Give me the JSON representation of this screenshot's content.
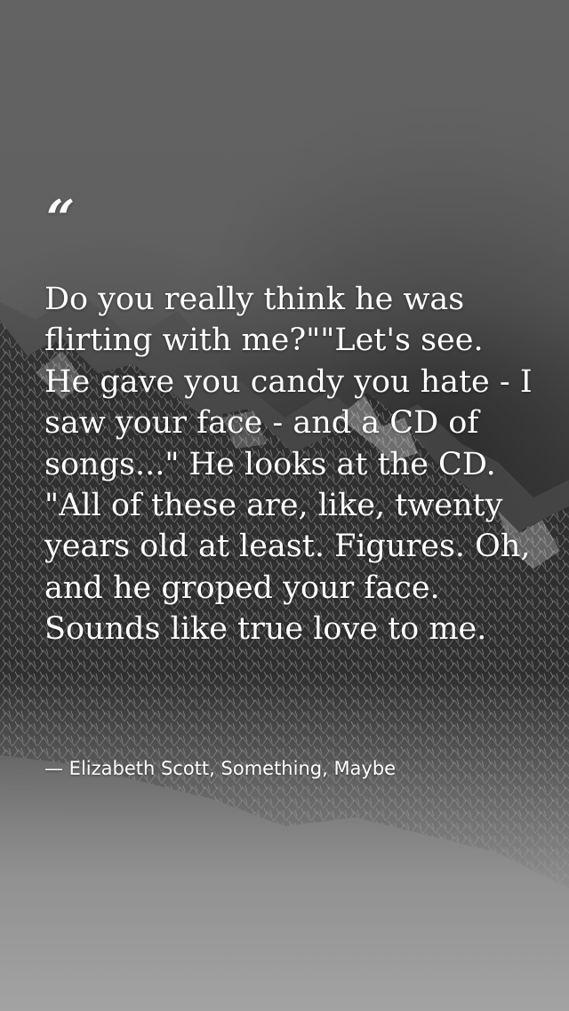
{
  "quote": {
    "mark": "“",
    "text": "Do you really think he was flirting with me?\"\"Let's see. He gave you candy you hate - I saw your face - and a CD of songs...\" He looks at the CD. \"All of these are, like, twenty years old at least. Figures. Oh, and he groped your face. Sounds like true love to me.",
    "attribution": "— Elizabeth Scott, Something, Maybe"
  },
  "background": {
    "subject": "snowy mountain range in fog",
    "tone": "monochrome grey"
  }
}
